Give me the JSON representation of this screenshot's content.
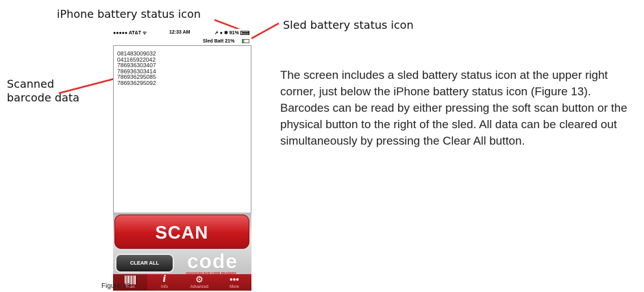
{
  "callouts": {
    "iphone_battery": "iPhone battery status icon",
    "sled_battery": "Sled battery status icon",
    "scanned_data": "Scanned barcode data"
  },
  "phone": {
    "status": {
      "carrier": "●●●●● AT&T ᯤ",
      "time": "12:33 AM",
      "right": "➚ ● ✱ 91%"
    },
    "sled_status": "Sled Batt  21%",
    "scans": [
      "081483009032",
      "041165922042",
      "786936303407",
      "786936303414",
      "786936295085",
      "786936295092"
    ],
    "scan_button": "SCAN",
    "clear_button": "CLEAR ALL",
    "logo": "code",
    "logo_sub": "ADVANCED BAR CODE READERS",
    "tabs": [
      {
        "label": "Scan",
        "icon": "barcode-icon"
      },
      {
        "label": "Info",
        "icon": "info-icon"
      },
      {
        "label": "Advanced",
        "icon": "gear-icon"
      },
      {
        "label": "More",
        "icon": "more-icon"
      }
    ]
  },
  "figure_caption": "Figure 13",
  "body": "The screen includes a sled battery status icon at the upper right corner, just below the iPhone battery status icon (Figure 13). Barcodes can be read by either pressing the soft scan button or the physical button to the right of the sled.  All data can be cleared out simultaneously by pressing the Clear All button.",
  "colors": {
    "accent": "#c8181c",
    "leader": "#e0302a"
  }
}
